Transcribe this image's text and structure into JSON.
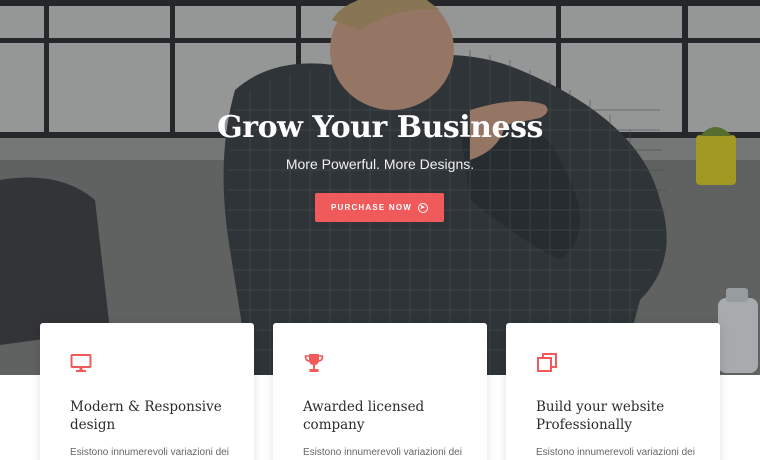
{
  "hero": {
    "title": "Grow Your Business",
    "subtitle": "More Powerful. More Designs.",
    "cta_label": "PURCHASE NOW",
    "cta_icon": "arrow-right-circle-icon"
  },
  "features": [
    {
      "icon": "monitor-icon",
      "title_line1": "Modern & Responsive",
      "title_line2": "design",
      "text": "Esistono innumerevoli variazioni dei"
    },
    {
      "icon": "trophy-icon",
      "title_line1": "Awarded licensed",
      "title_line2": "company",
      "text": "Esistono innumerevoli variazioni dei"
    },
    {
      "icon": "copy-icon",
      "title_line1": "Build your website",
      "title_line2": "Professionally",
      "text": "Esistono innumerevoli variazioni dei"
    }
  ],
  "colors": {
    "accent": "#f05a5a",
    "heading": "#2b2b2b",
    "body_text": "#666666",
    "hero_text": "#ffffff"
  }
}
